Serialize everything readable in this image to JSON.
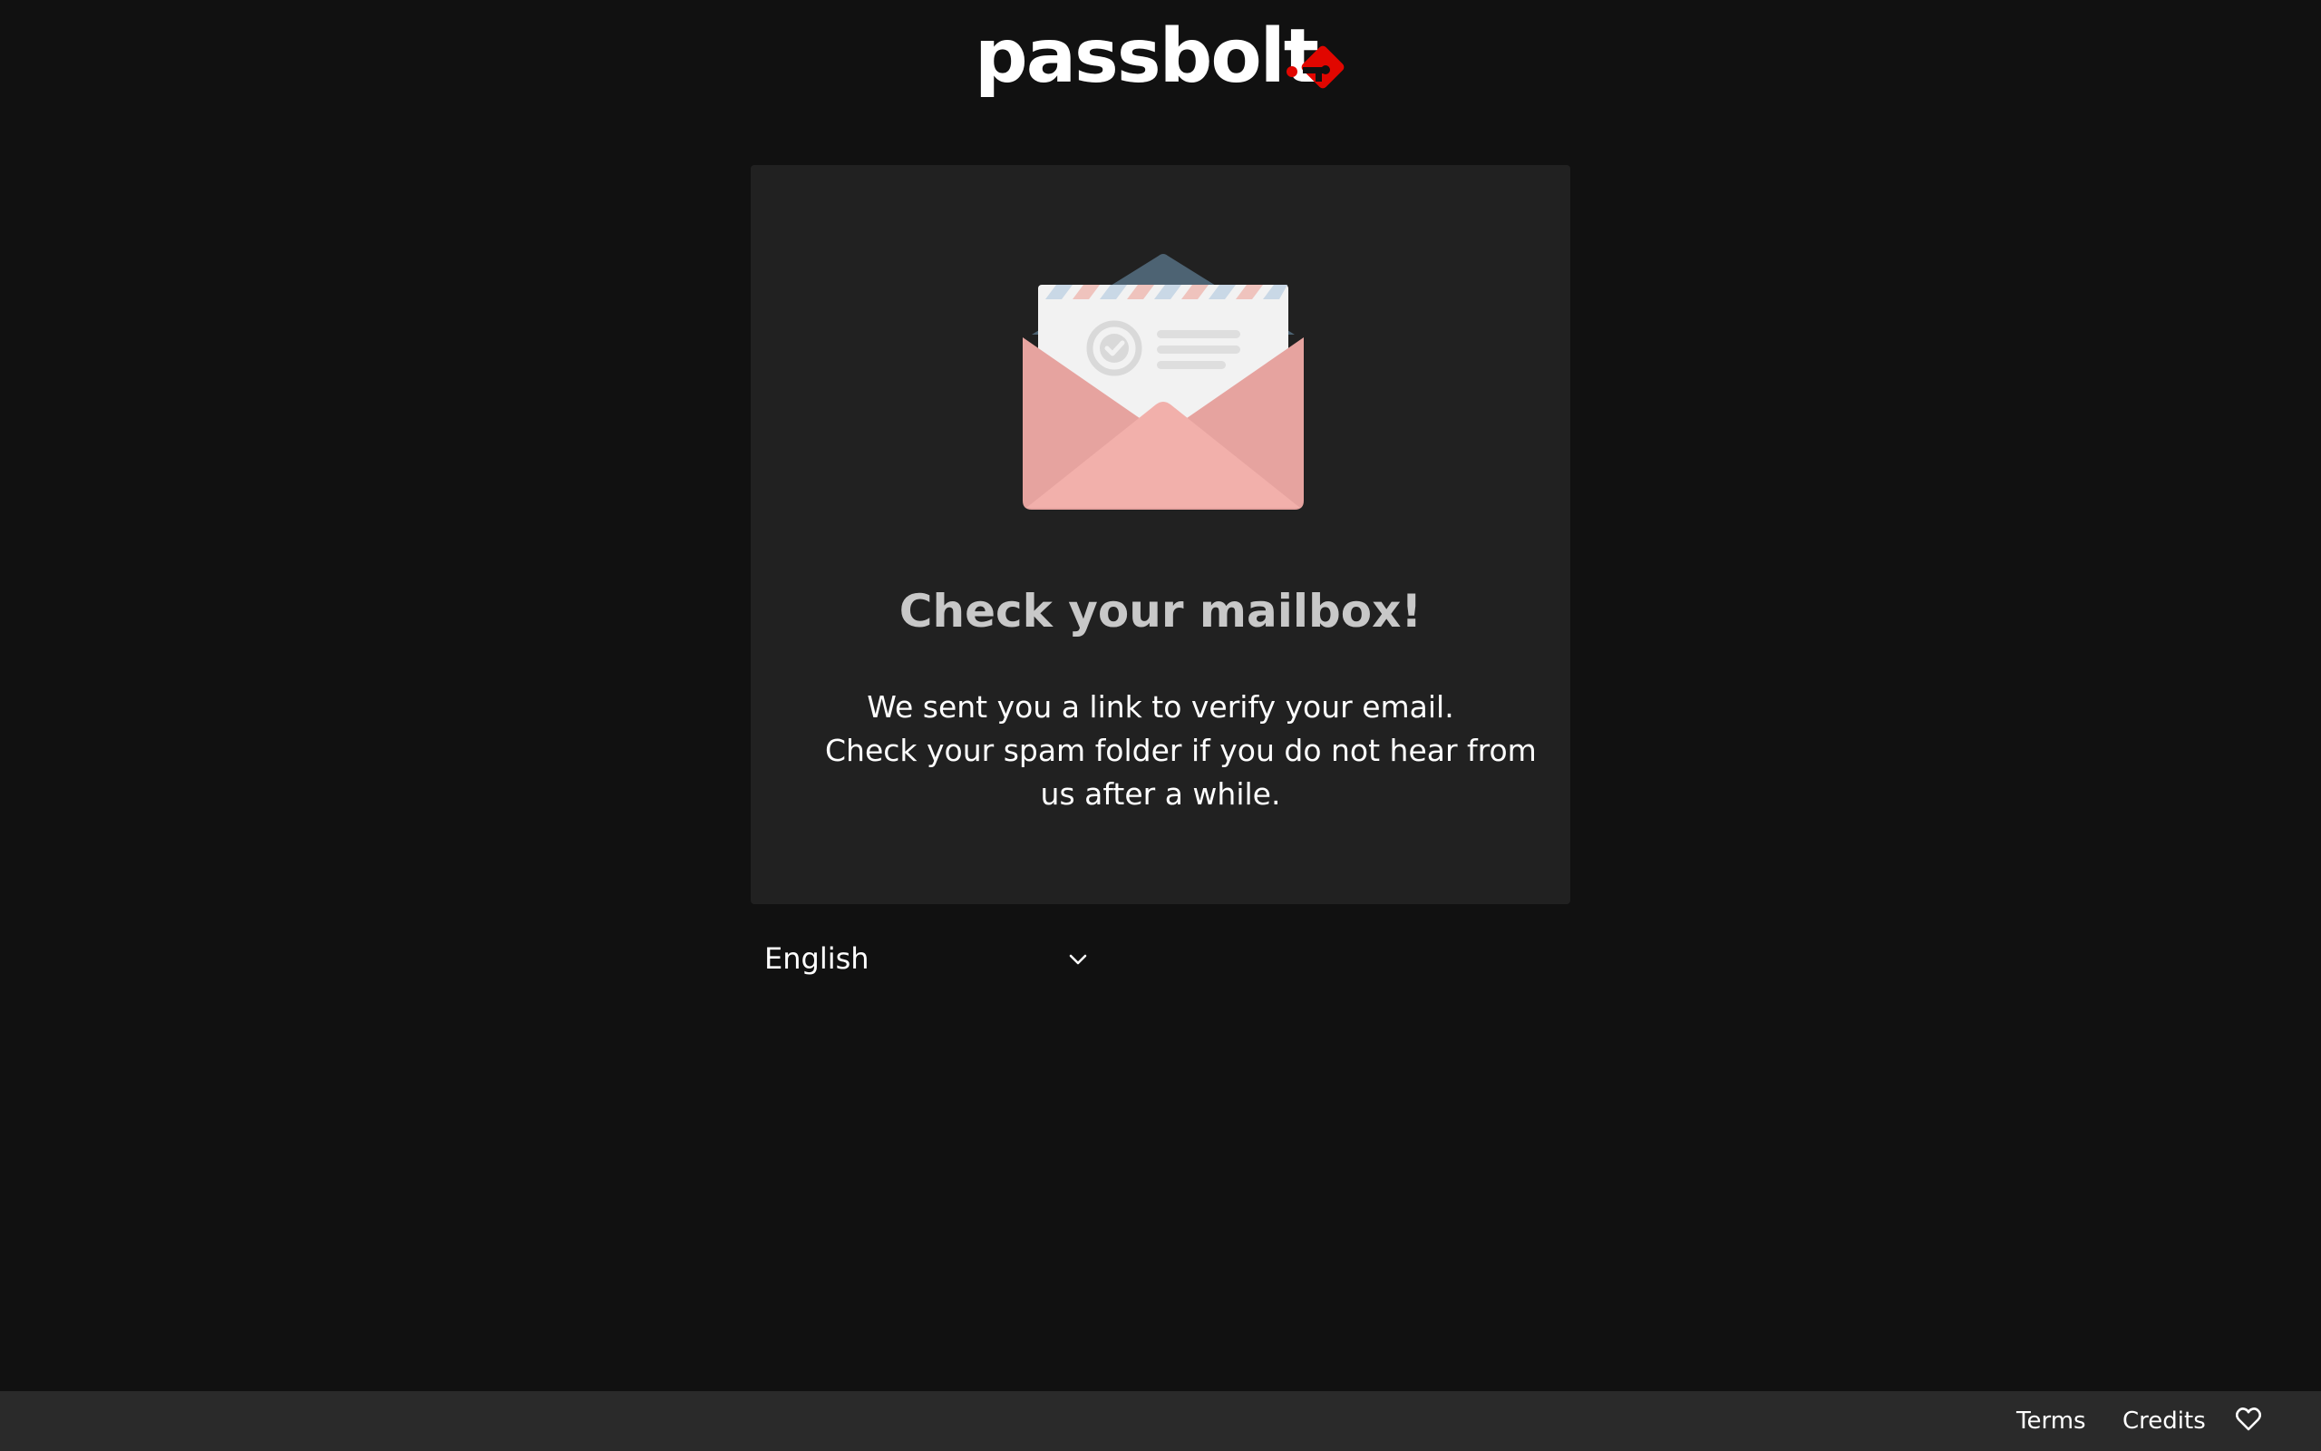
{
  "logo": {
    "text": "passbolt",
    "icon": "passbolt-key-icon",
    "accent": "#e10600"
  },
  "card": {
    "illustration": "envelope-icon",
    "title": "Check your mailbox!",
    "message_lines": [
      "We sent you a link to verify your email.",
      "Check your spam folder if you do not hear from",
      "us after a while."
    ]
  },
  "language": {
    "selected": "English",
    "icon": "chevron-down-icon"
  },
  "footer": {
    "terms": "Terms",
    "credits": "Credits",
    "icon": "heart-icon"
  },
  "colors": {
    "background": "#111111",
    "card": "#212121",
    "footer": "#2a2a2a",
    "title": "#c8c8c8"
  }
}
